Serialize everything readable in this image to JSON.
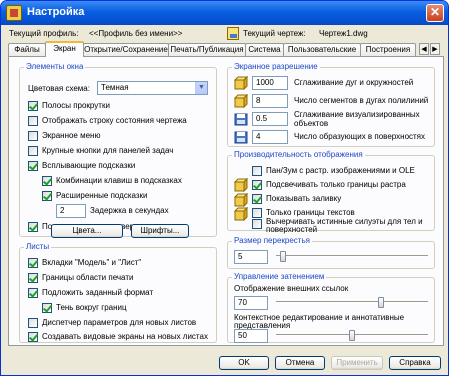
{
  "window": {
    "title": "Настройка",
    "close_glyph": "✕"
  },
  "profile": {
    "label": "Текущий профиль:",
    "value": "<<Профиль без имени>>",
    "drawing_label": "Текущий чертеж:",
    "drawing_value": "Чертеж1.dwg"
  },
  "tabs": [
    {
      "label": "Файлы"
    },
    {
      "label": "Экран"
    },
    {
      "label": "Открытие/Сохранение"
    },
    {
      "label": "Печать/Публикация"
    },
    {
      "label": "Система"
    },
    {
      "label": "Пользовательские"
    },
    {
      "label": "Построения"
    }
  ],
  "tab_scroll": {
    "left": "◀",
    "right": "▶"
  },
  "window_elements": {
    "title": "Элементы окна",
    "color_scheme_label": "Цветовая схема:",
    "color_scheme_value": "Темная",
    "dropdown_glyph": "▼",
    "checks": [
      {
        "label": "Полосы прокрутки",
        "checked": true
      },
      {
        "label": "Отображать строку состояния чертежа",
        "checked": false
      },
      {
        "label": "Экранное меню",
        "checked": false
      },
      {
        "label": "Крупные кнопки для панелей задач",
        "checked": false
      },
      {
        "label": "Всплывающие подсказки",
        "checked": true
      },
      {
        "label": "Комбинации клавиш в подсказках",
        "checked": true
      },
      {
        "label": "Расширенные подсказки",
        "checked": true
      }
    ],
    "delay_value": "2",
    "delay_label": "Задержка в секундах",
    "rollover_label": "Подсказки для ролловеров",
    "colors_button": "Цвета...",
    "fonts_button": "Шрифты..."
  },
  "sheets": {
    "title": "Листы",
    "checks": [
      {
        "label": "Вкладки \"Модель\" и \"Лист\"",
        "checked": true
      },
      {
        "label": "Границы области печати",
        "checked": true
      },
      {
        "label": "Подложить заданный формат",
        "checked": true
      },
      {
        "label": "Тень вокруг границ",
        "checked": true
      },
      {
        "label": "Диспетчер параметров для новых листов",
        "checked": false
      },
      {
        "label": "Создавать видовые экраны на новых листах",
        "checked": true
      }
    ]
  },
  "resolution": {
    "title": "Экранное разрешение",
    "rows": [
      {
        "value": "1000",
        "label": "Сглаживание дуг и окружностей"
      },
      {
        "value": "8",
        "label": "Число сегментов в дугах полилиний"
      },
      {
        "value": "0.5",
        "label": "Сглаживание визуализированных",
        "label2": "объектов"
      },
      {
        "value": "4",
        "label": "Число образующих в поверхностях"
      }
    ]
  },
  "performance": {
    "title": "Производительность отображения",
    "checks": [
      {
        "label": "Пан/Зум с растр. изображениями и OLE",
        "checked": false
      },
      {
        "label": "Подсвечивать только границы растра",
        "checked": true
      },
      {
        "label": "Показывать заливку",
        "checked": true
      },
      {
        "label": "Только границы текстов",
        "checked": false
      },
      {
        "label": "Вычерчивать истинные силуэты для тел и",
        "label2": "поверхностей",
        "checked": false
      }
    ]
  },
  "crosshair": {
    "title": "Размер перекрестья",
    "value": "5",
    "level_percent": 3
  },
  "fade": {
    "title": "Управление затенением",
    "xref_label": "Отображение внешних ссылок",
    "xref_value": "70",
    "xref_level_percent": 70,
    "inplace_label": "Контекстное редактирование и аннотативные",
    "inplace_label2": "представления",
    "inplace_value": "50",
    "inplace_level_percent": 50
  },
  "footer": {
    "ok": "OK",
    "cancel": "Отмена",
    "apply": "Применить",
    "help": "Справка"
  }
}
